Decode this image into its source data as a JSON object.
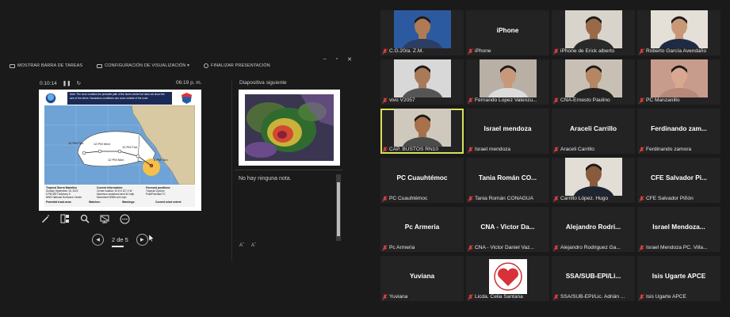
{
  "presenter": {
    "toolbar": {
      "taskbar": "MOSTRAR BARRA DE TAREAS",
      "display_settings": "CONFIGURACIÓN DE VISUALIZACIÓN ▾",
      "end_show": "FINALIZAR PRESENTACIÓN"
    },
    "timer": "0:10:14",
    "clock": "06:19 p. m.",
    "next_slide_label": "Diapositiva siguiente",
    "notes_text": "No hay ninguna nota.",
    "slide_counter": "2 de 5",
    "slide": {
      "note": "Note: The cone contains the probable path of the storm center but does not show the size of the storm. Hazardous conditions can occur outside of the cone.",
      "storm_title": "Tropical Storm Madeline",
      "storm_date": "Sunday September 18, 2022",
      "advisory": "5 PM MDT Advisory 5",
      "center": "NWS National Hurricane Center",
      "current_info_label": "Current information:",
      "current_center": "Center location 19.6 N 107.4 W",
      "max_wind": "Maximum sustained wind 40 mph",
      "movement": "Movement WNW at 8 mph",
      "forecast_label": "Forecast positions:",
      "forecast_a": "Tropical Cyclone",
      "forecast_b": "Post/Potential TC",
      "track_label": "Potential track area:",
      "watches_label": "Watches:",
      "warnings_label": "Warnings:",
      "wind_label": "Current wind extent:",
      "map_labels": [
        "12 PM Thu",
        "12 PM Wed",
        "12 PM Tue",
        "12 PM Mon",
        "8 PM Sun"
      ]
    }
  },
  "gallery": [
    {
      "name": "C.G.20/a. Z.M.",
      "big": "",
      "type": "video"
    },
    {
      "name": "iPhone",
      "big": "iPhone",
      "type": "name"
    },
    {
      "name": "iPhone de Erick alberto",
      "big": "",
      "type": "video"
    },
    {
      "name": "Roberto García Avendaño",
      "big": "",
      "type": "video"
    },
    {
      "name": "vivo V2057",
      "big": "",
      "type": "video"
    },
    {
      "name": "Fernando Lopez Valenzu...",
      "big": "",
      "type": "video"
    },
    {
      "name": "CNA-Ernesto Paulino",
      "big": "",
      "type": "video"
    },
    {
      "name": "PC Manzanillo",
      "big": "",
      "type": "video"
    },
    {
      "name": "CAP. BUSTOS RN10",
      "big": "",
      "type": "video"
    },
    {
      "name": "Israel mendoza",
      "big": "Israel mendoza",
      "type": "name"
    },
    {
      "name": "Araceli Carrillo",
      "big": "Araceli Carrillo",
      "type": "name"
    },
    {
      "name": "Ferdinando zamora",
      "big": "Ferdinando zam...",
      "type": "name"
    },
    {
      "name": "PC Cuauhtémoc",
      "big": "PC Cuauhtémoc",
      "type": "name"
    },
    {
      "name": "Tania Román CONAGUA",
      "big": "Tania Román CO...",
      "type": "name"
    },
    {
      "name": "Carrillo López. Hugo",
      "big": "",
      "type": "video"
    },
    {
      "name": "CFE Salvador Piñón",
      "big": "CFE Salvador Pi...",
      "type": "name"
    },
    {
      "name": "Pc Armeria",
      "big": "Pc Armeria",
      "type": "name"
    },
    {
      "name": "CNA - Victor Daniel Vaz...",
      "big": "CNA - Victor Da...",
      "type": "name"
    },
    {
      "name": "Alejandro Rodriguez Ga...",
      "big": "Alejandro Rodri...",
      "type": "name"
    },
    {
      "name": "Israel Mendoza PC. Villa...",
      "big": "Israel Mendoza...",
      "type": "name"
    },
    {
      "name": "Yuviana",
      "big": "Yuviana",
      "type": "name"
    },
    {
      "name": "Licda. Celia Santana",
      "big": "",
      "type": "logo"
    },
    {
      "name": "SSA/SUB-EPI/Lic. Adrián ...",
      "big": "SSA/SUB-EPI/Li...",
      "type": "name"
    },
    {
      "name": "Isis Ugarte APCE",
      "big": "Isis Ugarte APCE",
      "type": "name"
    }
  ],
  "colors": {
    "active_speaker": "#d7e35b",
    "muted_mic": "#e0413a",
    "tile_bg": "#232323"
  }
}
